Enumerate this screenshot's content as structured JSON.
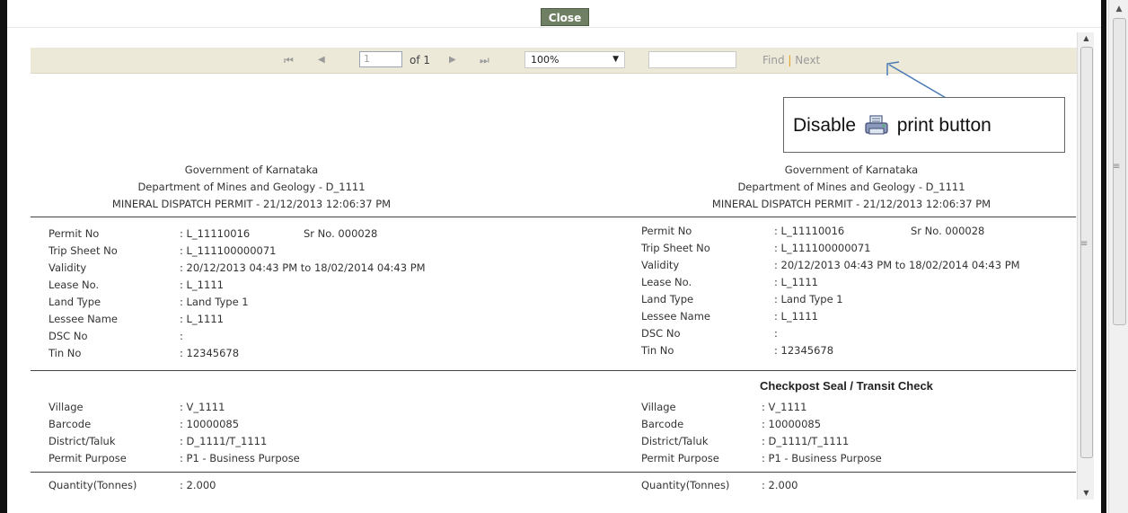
{
  "dialog": {
    "close_label": "Close"
  },
  "toolbar": {
    "first_icon": "⏮",
    "prev_icon": "◀",
    "page_value": "1",
    "of_label": "of 1",
    "next_icon": "▶",
    "last_icon": "⏭",
    "zoom_value": "100%",
    "find_label": "Find",
    "find_separator": "|",
    "next_label": "Next"
  },
  "callout": {
    "text_before": "Disable",
    "text_after": "print button",
    "icon": "printer-icon"
  },
  "permit": {
    "header": {
      "line1": "Government of Karnataka",
      "line2": "Department of Mines and Geology - D_1111",
      "line3": "MINERAL DISPATCH PERMIT - 21/12/2013 12:06:37 PM"
    },
    "fields": [
      {
        "label": "Permit No",
        "value": ": L_11110016",
        "extra": "Sr No. 000028"
      },
      {
        "label": "Trip Sheet No",
        "value": ": L_111100000071"
      },
      {
        "label": "Validity",
        "value": ": 20/12/2013 04:43 PM to 18/02/2014 04:43 PM"
      },
      {
        "label": "Lease No.",
        "value": ": L_1111"
      },
      {
        "label": "Land Type",
        "value": ": Land Type 1"
      },
      {
        "label": "Lessee Name",
        "value": ": L_1111"
      },
      {
        "label": "DSC No",
        "value": ":"
      },
      {
        "label": "Tin No",
        "value": ": 12345678"
      }
    ],
    "checkpost_title": "Checkpost Seal / Transit Check",
    "fields2": [
      {
        "label": "Village",
        "value": ": V_1111"
      },
      {
        "label": "Barcode",
        "value": ": 10000085"
      },
      {
        "label": "District/Taluk",
        "value": ": D_1111/T_1111"
      },
      {
        "label": "Permit Purpose",
        "value": ": P1 - Business Purpose"
      }
    ],
    "fields3": [
      {
        "label": "Quantity(Tonnes)",
        "value": ": 2.000"
      }
    ]
  }
}
